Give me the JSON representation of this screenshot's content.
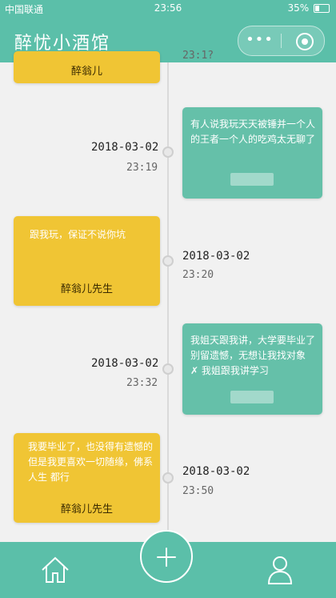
{
  "status_bar": {
    "carrier": "中国联通",
    "time": "23:56",
    "battery": "35%"
  },
  "header": {
    "title": "醉忧小酒馆",
    "more_label": "•••"
  },
  "timeline": {
    "top_time_partial": "23:1?",
    "top_card_author": "醉翁儿",
    "entries": [
      {
        "date": "2018-03-02",
        "time": "23:19",
        "text": "有人说我玩天天被锤并一个人的王者一个人的吃鸡太无聊了",
        "author": ""
      },
      {
        "date": "2018-03-02",
        "time": "23:20",
        "text": "跟我玩，保证不说你坑",
        "author": "醉翁儿先生"
      },
      {
        "date": "2018-03-02",
        "time": "23:32",
        "text": "我姐天跟我讲，大学要毕业了别留遗憾，无想让我找对象 ✗ 我姐跟我讲学习",
        "author": ""
      },
      {
        "date": "2018-03-02",
        "time": "23:50",
        "text": "我要毕业了，也没得有遗憾的 但是我更喜欢一切随缘，佛系人生 都行",
        "author": "醉翁儿先生"
      }
    ]
  },
  "nav": {
    "home_icon": "home-icon",
    "add_icon": "plus-icon",
    "user_icon": "user-icon"
  },
  "colors": {
    "accent": "#5bbfa9",
    "yellow_card": "#f0c534",
    "green_card": "#65c0a9"
  }
}
